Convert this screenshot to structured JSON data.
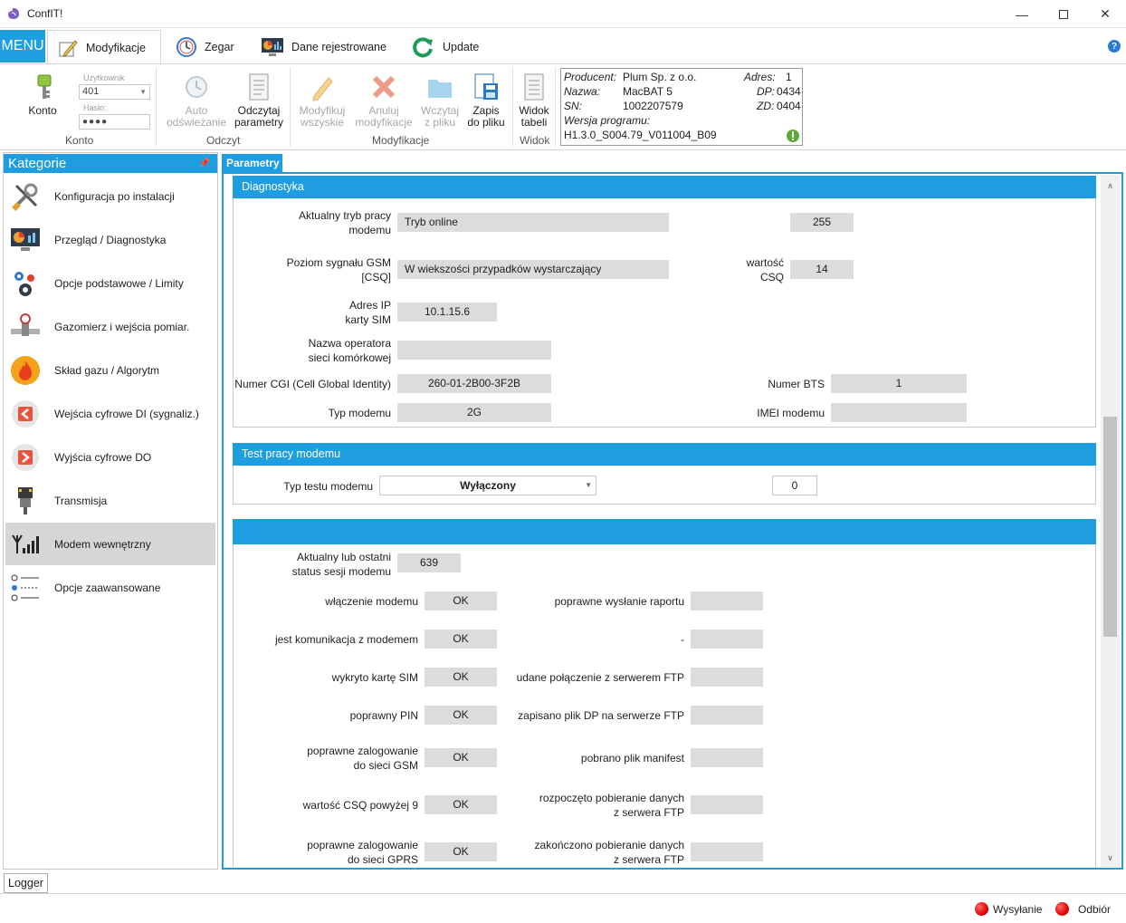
{
  "window": {
    "title": "ConfIT!",
    "minimize_icon": "minimize-icon",
    "maximize_icon": "maximize-icon",
    "close_icon": "close-icon"
  },
  "ribbon_tabs": {
    "menu": "MENU",
    "tabs": [
      {
        "label": "Modyfikacje",
        "icon": "pencil-icon",
        "active": true
      },
      {
        "label": "Zegar",
        "icon": "clock-icon"
      },
      {
        "label": "Dane rejestrowane",
        "icon": "chart-monitor-icon"
      },
      {
        "label": "Update",
        "icon": "refresh-icon"
      }
    ]
  },
  "ribbon": {
    "konto": {
      "button": "Konto",
      "user_label": "Uzytkownik",
      "user_value": "401",
      "password_label": "Hasło:",
      "password_value": "●●●●",
      "group": "Konto"
    },
    "odczyt": {
      "auto_line1": "Auto",
      "auto_line2": "odświeżanie",
      "read_line1": "Odczytaj",
      "read_line2": "parametry",
      "group": "Odczyt"
    },
    "modyfikacje": {
      "modify_line1": "Modyfikuj",
      "modify_line2": "wszyskie",
      "cancel_line1": "Anuluj",
      "cancel_line2": "modyfikacje",
      "load_line1": "Wczytaj",
      "load_line2": "z pliku",
      "save_line1": "Zapis",
      "save_line2": "do pliku",
      "group": "Modyfikacje"
    },
    "widok": {
      "table_line1": "Widok",
      "table_line2": "tabeli",
      "group": "Widok"
    },
    "info": {
      "producer_label": "Producent:",
      "producer": "Plum Sp. z o.o.",
      "name_label": "Nazwa:",
      "name": "MacBAT 5",
      "sn_label": "SN:",
      "sn": "1002207579",
      "version_label": "Wersja programu:",
      "version": "H1.3.0_S004.79_V011004_B09",
      "address_label": "Adres:",
      "address": "1",
      "dp_label": "DP:",
      "dp": "0434",
      "zd_label": "ZD:",
      "zd": "0404"
    }
  },
  "categories": {
    "header": "Kategorie",
    "items": [
      {
        "label": "Konfiguracja po instalacji",
        "icon": "tools-icon"
      },
      {
        "label": "Przegląd / Diagnostyka",
        "icon": "dashboard-monitor-icon"
      },
      {
        "label": "Opcje podstawowe / Limity",
        "icon": "gears-icon"
      },
      {
        "label": "Gazomierz i wejścia pomiar.",
        "icon": "gas-meter-icon"
      },
      {
        "label": "Skład gazu / Algorytm",
        "icon": "flame-icon"
      },
      {
        "label": "Wejścia cyfrowe DI (sygnaliz.)",
        "icon": "digital-input-icon"
      },
      {
        "label": "Wyjścia cyfrowe DO",
        "icon": "digital-output-icon"
      },
      {
        "label": "Transmisja",
        "icon": "connector-icon"
      },
      {
        "label": "Modem wewnętrzny",
        "icon": "signal-antenna-icon",
        "selected": true
      },
      {
        "label": "Opcje zaawansowane",
        "icon": "options-list-icon"
      }
    ]
  },
  "main": {
    "tab": "Parametry",
    "diagnostyka": {
      "header": "Diagnostyka",
      "mode_label_1": "Aktualny tryb pracy",
      "mode_label_2": "modemu",
      "mode_value": "Tryb online",
      "mode_code": "255",
      "gsm_label_1": "Poziom sygnału GSM",
      "gsm_label_2": "[CSQ]",
      "gsm_value": "W wiekszości przypadków wystarczający",
      "csq_label_1": "wartość",
      "csq_label_2": "CSQ",
      "csq_value": "14",
      "ip_label_1": "Adres IP",
      "ip_label_2": "karty SIM",
      "ip_value": "10.1.15.6",
      "operator_label_1": "Nazwa operatora",
      "operator_label_2": "sieci komórkowej",
      "operator_value": "",
      "cgi_label": "Numer CGI (Cell Global Identity)",
      "cgi_value": "260-01-2B00-3F2B",
      "bts_label": "Numer BTS",
      "bts_value": "1",
      "type_label": "Typ modemu",
      "type_value": "2G",
      "imei_label": "IMEI modemu",
      "imei_value": ""
    },
    "test": {
      "header": "Test pracy modemu",
      "label": "Typ testu modemu",
      "select_value": "Wyłączony",
      "number_value": "0"
    },
    "session": {
      "header": "",
      "status_label_1": "Aktualny lub ostatni",
      "status_label_2": "status sesji modemu",
      "status_value": "639",
      "left": [
        {
          "l1": "włączenie modemu",
          "l2": "",
          "value": "OK"
        },
        {
          "l1": "jest komunikacja z modemem",
          "l2": "",
          "value": "OK"
        },
        {
          "l1": "wykryto kartę SIM",
          "l2": "",
          "value": "OK"
        },
        {
          "l1": "poprawny PIN",
          "l2": "",
          "value": "OK"
        },
        {
          "l1": "poprawne zalogowanie",
          "l2": "do sieci GSM",
          "value": "OK"
        },
        {
          "l1": "wartość CSQ powyżej 9",
          "l2": "",
          "value": "OK"
        },
        {
          "l1": "poprawne zalogowanie",
          "l2": "do sieci GPRS",
          "value": "OK"
        }
      ],
      "right": [
        {
          "l1": "poprawne wysłanie raportu",
          "l2": "",
          "value": ""
        },
        {
          "l1": "-",
          "l2": "",
          "value": ""
        },
        {
          "l1": "udane połączenie z serwerem FTP",
          "l2": "",
          "value": ""
        },
        {
          "l1": "zapisano plik DP na serwerze FTP",
          "l2": "",
          "value": ""
        },
        {
          "l1": "pobrano plik manifest",
          "l2": "",
          "value": ""
        },
        {
          "l1": "rozpoczęto pobieranie danych",
          "l2": "z serwera FTP",
          "value": ""
        },
        {
          "l1": "zakończono pobieranie danych",
          "l2": "z serwera FTP",
          "value": ""
        }
      ]
    }
  },
  "bottom": {
    "logger": "Logger",
    "sending": "Wysyłanie",
    "receiving": "Odbiór"
  },
  "colors": {
    "accent": "#1e9de0",
    "field_bg": "#dcdcdc",
    "selected_bg": "#d6d6d6",
    "led": "#e00000"
  }
}
